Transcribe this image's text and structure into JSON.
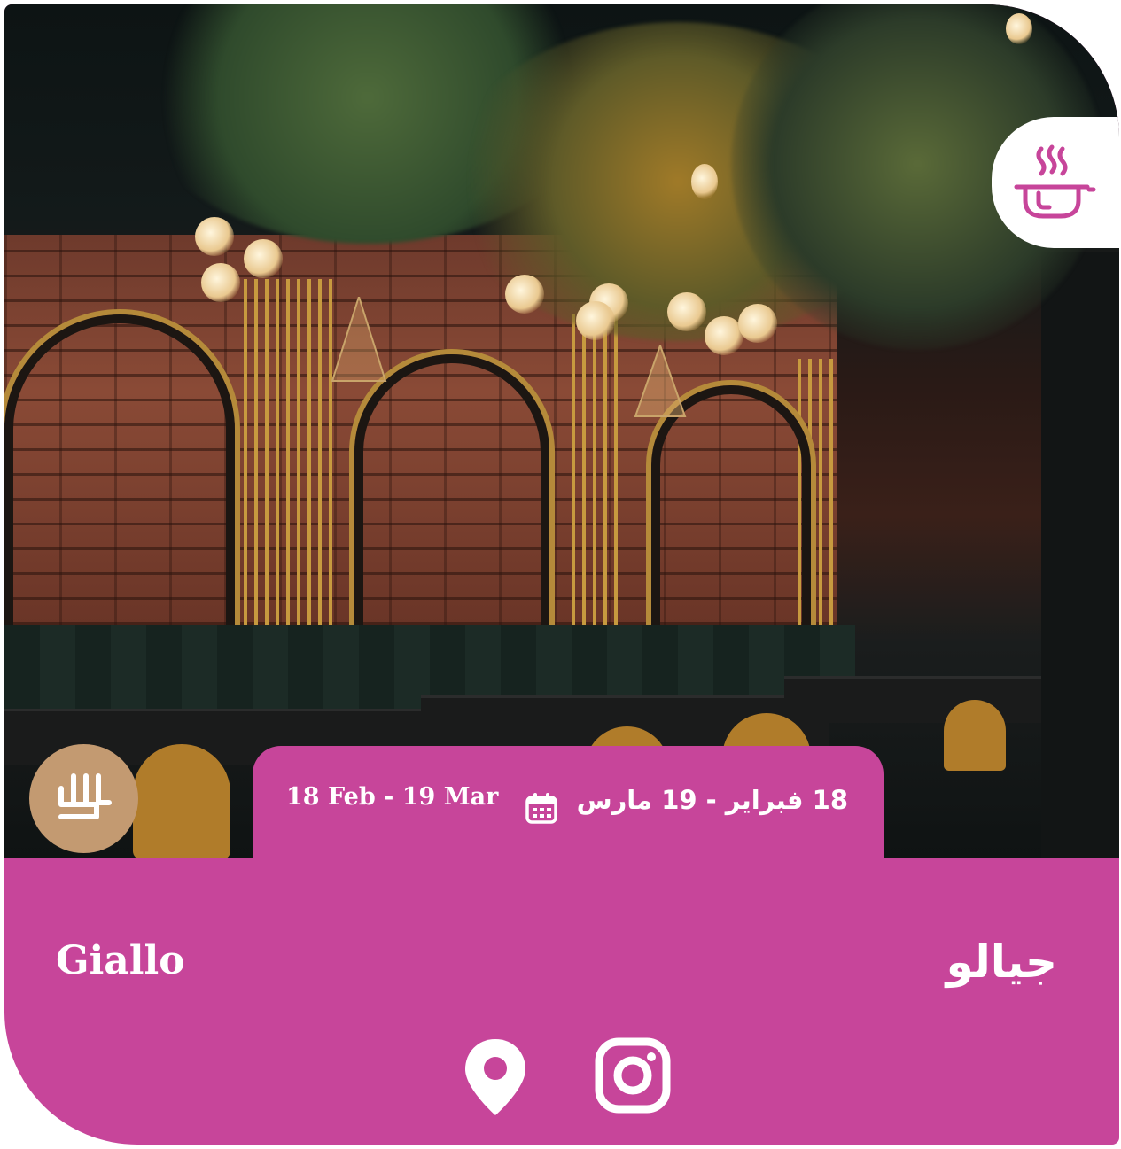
{
  "card": {
    "name_en": "Giallo",
    "name_ar": "جيالو",
    "date_en": "18 Feb - 19 Mar",
    "date_ar": "18 فبراير - 19 مارس",
    "category_icon": "food-pot-icon",
    "logo_icon": "brand-monogram-icon",
    "calendar_icon": "calendar-icon",
    "location_icon": "location-pin-icon",
    "social_icon": "instagram-icon"
  },
  "colors": {
    "accent": "#c7459a",
    "logo_bg": "#c39a71",
    "white": "#ffffff"
  }
}
